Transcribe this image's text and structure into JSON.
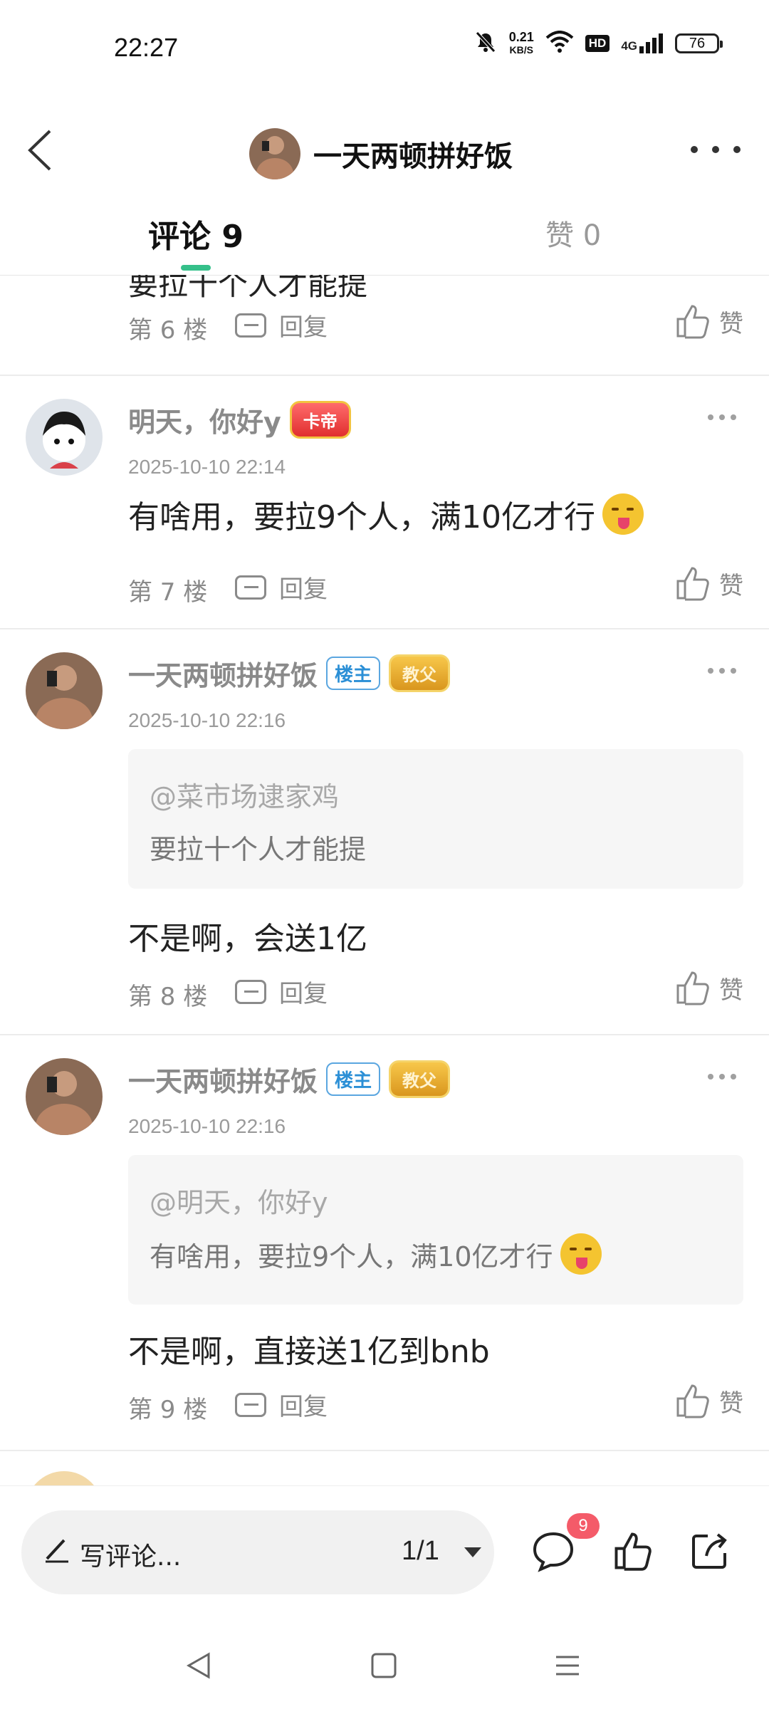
{
  "status_bar": {
    "time": "22:27",
    "net_speed_value": "0.21",
    "net_speed_unit": "KB/S",
    "hd_label": "HD",
    "network_label": "4G",
    "battery": "76"
  },
  "header": {
    "title": "一天两顿拼好饭",
    "back_icon": "chevron-left-icon",
    "more_icon": "more-dots-icon"
  },
  "tabs": {
    "comments_label": "评论 9",
    "likes_label": "赞 0"
  },
  "feed": {
    "clipped_text": "要拉十个人才能提",
    "floor6": {
      "floor": "第 6 楼",
      "reply": "回复",
      "like": "赞"
    },
    "comments": [
      {
        "username": "明天，你好y",
        "medal": "卡帝",
        "time": "2025-10-10 22:14",
        "content": "有啥用，要拉9个人，满10亿才行",
        "floor": "第 7 楼",
        "reply": "回复",
        "like": "赞"
      },
      {
        "username": "一天两顿拼好饭",
        "owner_tag": "楼主",
        "medal": "教父",
        "time": "2025-10-10 22:16",
        "quote_user": "@菜市场逮家鸡",
        "quote_text": "要拉十个人才能提",
        "content": "不是啊，会送1亿",
        "floor": "第 8 楼",
        "reply": "回复",
        "like": "赞"
      },
      {
        "username": "一天两顿拼好饭",
        "owner_tag": "楼主",
        "medal": "教父",
        "time": "2025-10-10 22:16",
        "quote_user": "@明天，你好y",
        "quote_text": "有啥用，要拉9个人，满10亿才行",
        "content": "不是啊，直接送1亿到bnb",
        "floor": "第 9 楼",
        "reply": "回复",
        "like": "赞"
      }
    ]
  },
  "bottom_bar": {
    "write_placeholder": "写评论...",
    "page_indicator": "1/1",
    "comment_badge": "9"
  },
  "colors": {
    "accent_green": "#35c08a",
    "badge_red": "#f45b69",
    "owner_blue": "#2b8fd6"
  }
}
